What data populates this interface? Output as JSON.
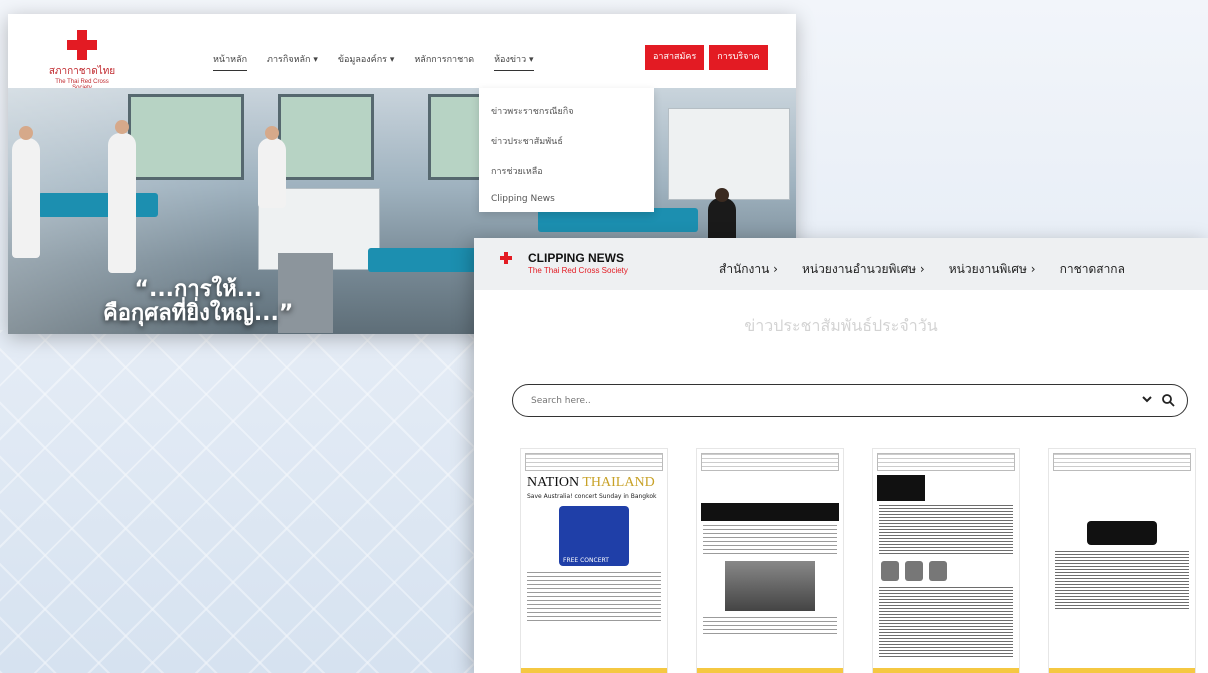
{
  "site": {
    "logo_text": "สภากาชาดไทย",
    "logo_subtext": "The Thai Red Cross Society",
    "menu": [
      {
        "label": "หน้าหลัก"
      },
      {
        "label": "ภารกิจหลัก ▾"
      },
      {
        "label": "ข้อมูลองค์กร ▾"
      },
      {
        "label": "หลักการกาชาด"
      },
      {
        "label": "ห้องข่าว ▾"
      }
    ],
    "btn_volunteer": "อาสาสมัคร",
    "btn_donate": "การบริจาค",
    "hero_line1": "“...การให้...",
    "hero_line2": "คือกุศลที่ยิ่งใหญ่...”",
    "dropdown": [
      {
        "label": "ข่าวพระราชกรณียกิจ"
      },
      {
        "label": "ข่าวประชาสัมพันธ์"
      },
      {
        "label": "การช่วยเหลือ"
      },
      {
        "label": "Clipping News"
      }
    ]
  },
  "clipping": {
    "title": "CLIPPING NEWS",
    "subtitle": "The Thai Red Cross Society",
    "nav": [
      {
        "label": "สำนักงาน ›"
      },
      {
        "label": "หน่วยงานอำนวยพิเศษ ›"
      },
      {
        "label": "หน่วยงานพิเศษ ›"
      },
      {
        "label": "กาชาดสากล"
      }
    ],
    "heading": "ข่าวประชาสัมพันธ์ประจำวัน",
    "search_placeholder": "Search here..",
    "cards": [
      {
        "masthead": "NATION",
        "masthead_accent": "THAILAND",
        "subhead": "Save Australia! concert Sunday in Bangkok",
        "poster_text": "FREE CONCERT"
      },
      {
        "masthead": ""
      },
      {
        "masthead": ""
      },
      {
        "masthead": ""
      }
    ]
  },
  "colors": {
    "brand_red": "#e31b23",
    "accent_gold": "#f5c842"
  }
}
